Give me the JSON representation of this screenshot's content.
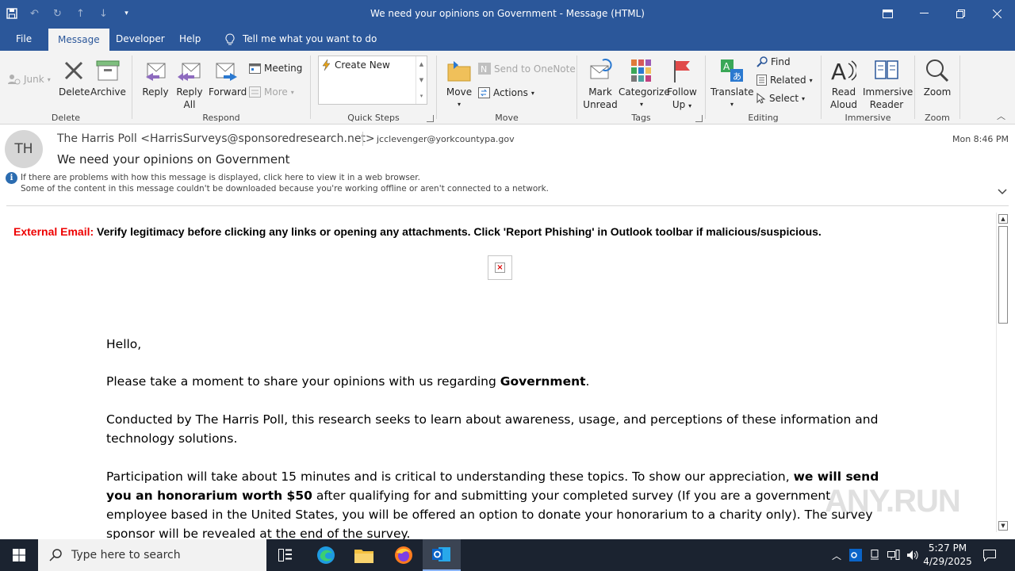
{
  "window": {
    "title": "We need your opinions on Government  -  Message (HTML)"
  },
  "qat": {
    "icons": [
      "save-icon",
      "undo-icon",
      "redo-icon",
      "up-arrow-icon",
      "down-arrow-icon",
      "customize-icon"
    ]
  },
  "tabs": [
    {
      "label": "File"
    },
    {
      "label": "Message",
      "active": true
    },
    {
      "label": "Developer"
    },
    {
      "label": "Help"
    },
    {
      "label": "Tell me what you want to do"
    }
  ],
  "ribbon": {
    "delete": {
      "label": "Delete",
      "junk": "Junk",
      "delete_btn": "Delete",
      "archive": "Archive"
    },
    "respond": {
      "label": "Respond",
      "reply": "Reply",
      "reply_all_1": "Reply",
      "reply_all_2": "All",
      "forward": "Forward",
      "meeting": "Meeting",
      "more": "More"
    },
    "quicksteps": {
      "label": "Quick Steps",
      "create_new": "Create New"
    },
    "move": {
      "label": "Move",
      "move_btn": "Move",
      "onenote": "Send to OneNote",
      "actions": "Actions"
    },
    "tags": {
      "label": "Tags",
      "mark_1": "Mark",
      "mark_2": "Unread",
      "categorize": "Categorize",
      "follow_1": "Follow",
      "follow_2": "Up"
    },
    "editing": {
      "label": "Editing",
      "translate": "Translate",
      "find": "Find",
      "related": "Related",
      "select": "Select"
    },
    "immersive": {
      "label": "Immersive",
      "read_1": "Read",
      "read_2": "Aloud",
      "reader_1": "Immersive",
      "reader_2": "Reader"
    },
    "zoom": {
      "label": "Zoom",
      "zoom_btn": "Zoom"
    }
  },
  "header": {
    "initials": "TH",
    "sender": "The Harris Poll <HarrisSurveys@sponsoredresearch.net>",
    "recipient": "jcclevenger@yorkcountypa.gov",
    "date": "Mon 8:46 PM",
    "subject": "We need your opinions on Government",
    "info_line1": "If there are problems with how this message is displayed, click here to view it in a web browser.",
    "info_line2": "Some of the content in this message couldn't be downloaded because you're working offline or aren't connected to a network."
  },
  "body": {
    "warning_prefix": "External Email:",
    "warning_text": " Verify legitimacy before clicking any links or opening any attachments. Click 'Report Phishing' in Outlook toolbar if malicious/suspicious.",
    "greeting": "Hello,",
    "p1_a": "Please take a moment to share your opinions with us regarding ",
    "p1_b": "Government",
    "p1_c": ".",
    "p2": "Conducted by The Harris Poll, this research seeks to learn about awareness, usage, and perceptions of these information and technology solutions.",
    "p3_a": "Participation will take about 15 minutes and is critical to understanding these topics. To show our appreciation, ",
    "p3_b": "we will send you an honorarium worth $50",
    "p3_c": " after qualifying for and submitting your completed survey (If you are a government employee based in the United States, you will be offered an option to donate your honorarium to a charity only). The survey sponsor will be revealed at the end of the survey."
  },
  "watermark": "ANY.RUN",
  "taskbar": {
    "search_placeholder": "Type here to search",
    "time": "5:27 PM",
    "date": "4/29/2025"
  }
}
